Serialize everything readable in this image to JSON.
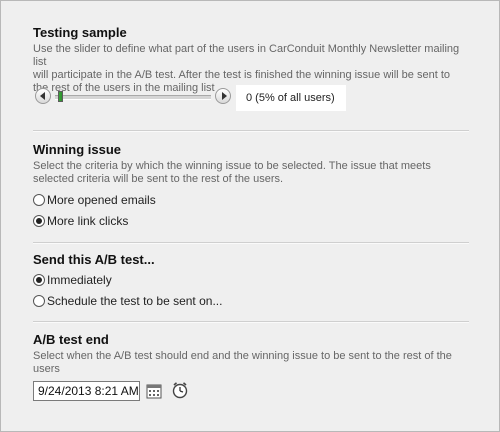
{
  "testing_sample": {
    "title": "Testing sample",
    "desc_line1": "Use the slider to define what part of the users in CarConduit Monthly Newsletter mailing list",
    "desc_line2": "will participate in the A/B test. After the test is finished the winning issue will be sent to",
    "desc_line3": "the rest of the users in the mailing list",
    "slider_value_fraction": 0.05,
    "value_label": "0 (5% of all users)"
  },
  "winning_issue": {
    "title": "Winning issue",
    "desc_line1": "Select the criteria by which the winning issue to be selected. The issue that meets",
    "desc_line2": "selected criteria will be sent to the rest of the users.",
    "options": [
      {
        "label": "More opened emails",
        "checked": false
      },
      {
        "label": "More link clicks",
        "checked": true
      }
    ]
  },
  "send_test": {
    "title": "Send this A/B test...",
    "options": [
      {
        "label": "Immediately",
        "checked": true
      },
      {
        "label": "Schedule the test to be sent on...",
        "checked": false
      }
    ]
  },
  "test_end": {
    "title": "A/B test end",
    "desc_line1": "Select when the A/B test should end and the winning issue to be sent to the rest of the",
    "desc_line2": "users",
    "date_value": "9/24/2013 8:21 AM",
    "calendar_icon": "calendar-icon",
    "clock_icon": "clock-icon"
  }
}
